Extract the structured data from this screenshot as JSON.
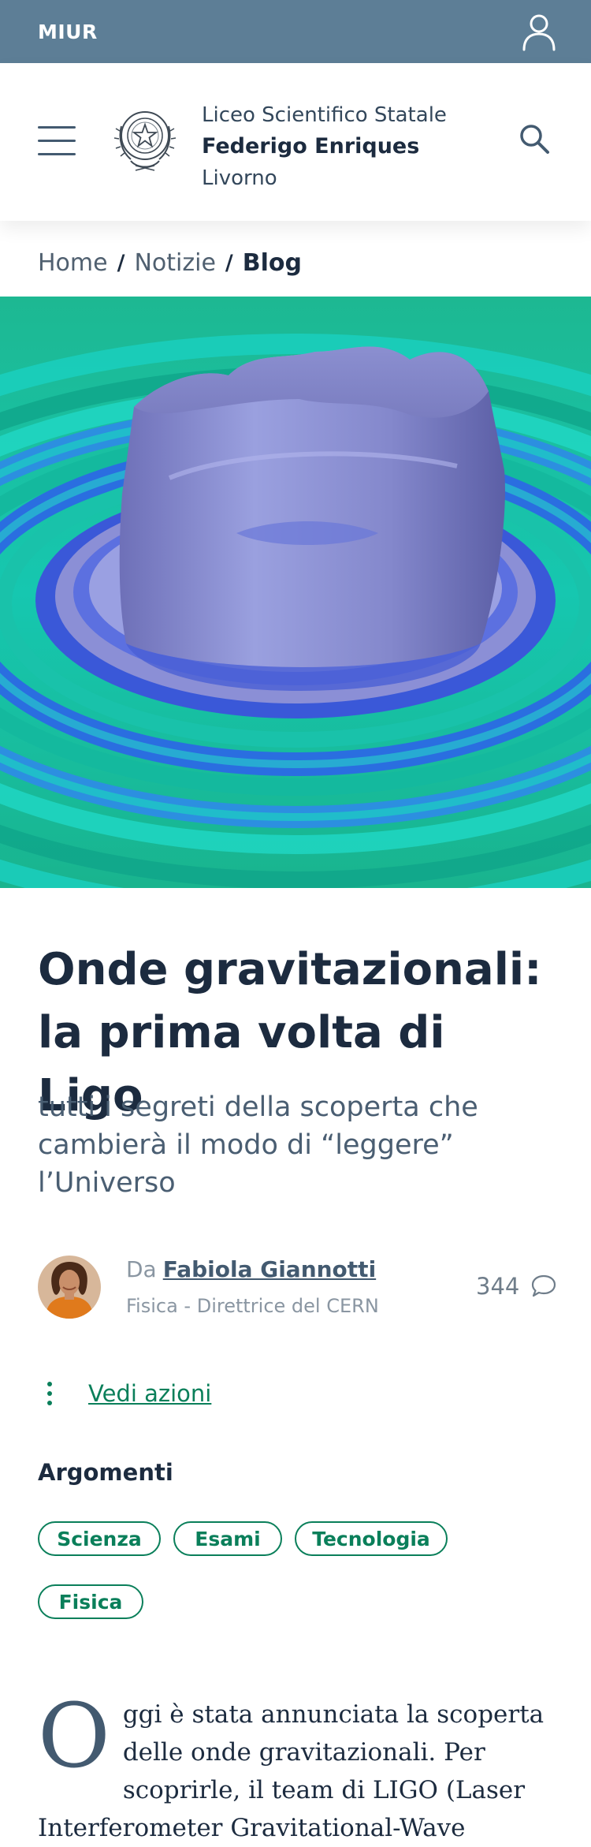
{
  "topbar": {
    "brand": "MIUR",
    "user_icon": "user-icon",
    "color": "#5d7e96"
  },
  "header": {
    "menu_icon": "hamburger-menu-icon",
    "emblem_icon": "italian-republic-emblem-icon",
    "school_line1": "Liceo Scientifico Statale",
    "school_line2": "Federigo Enriques",
    "school_line3": "Livorno",
    "search_icon": "search-icon"
  },
  "breadcrumb": {
    "items": [
      "Home",
      "Notizie",
      "Blog"
    ],
    "separator": "/"
  },
  "hero": {
    "image": "gravitational-wave-simulation"
  },
  "article": {
    "title_line1": "Onde gravitazionali:",
    "title_line2": "la prima volta di Ligo",
    "subtitle": "tutti i segreti della scoperta che cambierà il modo di “leggere” l’Universo",
    "author_prefix": "Da",
    "author_name": "Fabiola Giannotti",
    "author_role": "Fisica - Direttrice del CERN",
    "comment_count": "344",
    "actions_label": "Vedi azioni",
    "topics_heading": "Argomenti",
    "topics": [
      "Scienza",
      "Esami",
      "Tecnologia",
      "Fisica"
    ],
    "body_dropcap": "O",
    "body_text": "ggi è stata annunciata la scoperta delle onde gravitazionali. Per scoprirle, il team di LIGO (Laser Interferometer Gravitational-Wave"
  },
  "colors": {
    "primary_dark": "#1c2b3f",
    "accent_green": "#0a7f5a",
    "slate": "#435a70"
  }
}
